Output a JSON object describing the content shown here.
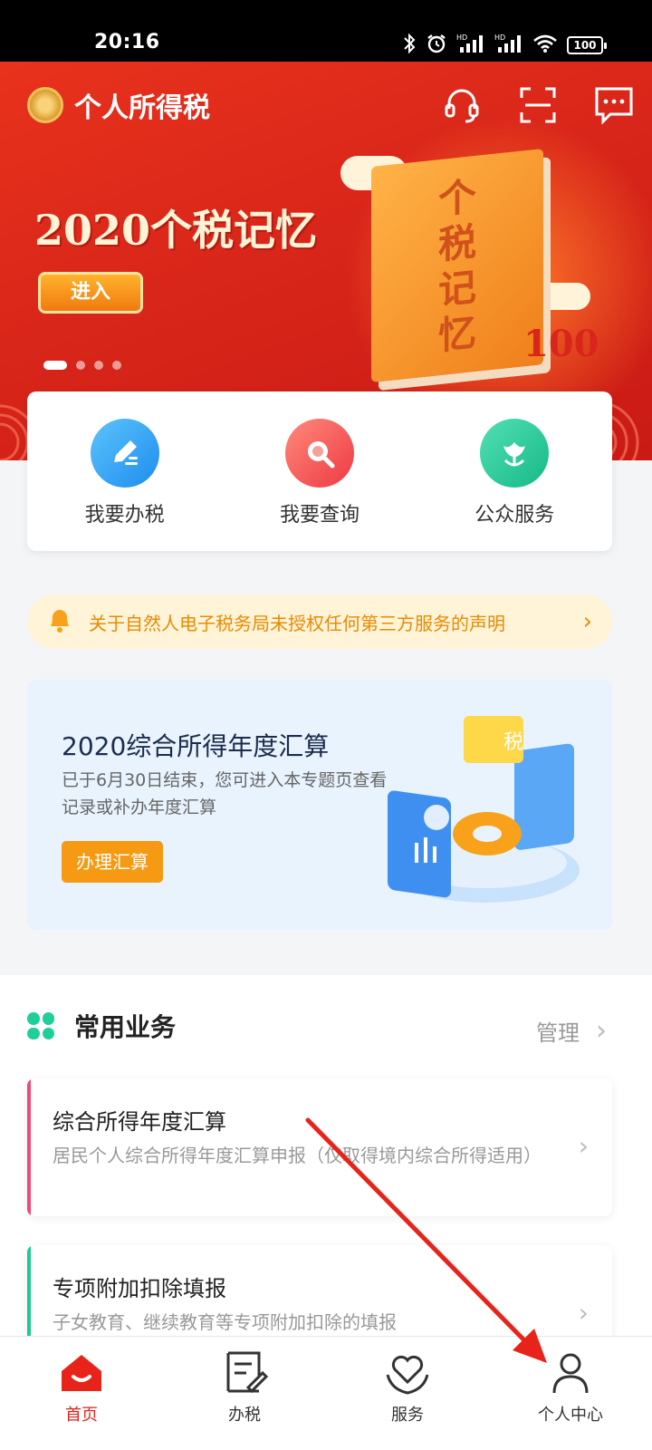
{
  "status_bar": {
    "time": "20:16",
    "battery": "100",
    "icons": [
      "bluetooth-icon",
      "alarm-icon",
      "signal-hd-icon",
      "signal-hd-icon",
      "wifi-icon",
      "battery-icon"
    ]
  },
  "header": {
    "app_title": "个人所得税",
    "icons": [
      "headset-icon",
      "scan-icon",
      "message-icon"
    ]
  },
  "banner": {
    "title": "2020个税记忆",
    "button": "进入",
    "book_text": "个税记忆",
    "badge": "100",
    "page_count": 4,
    "active_page": 1
  },
  "quick_actions": [
    {
      "label": "我要办税",
      "icon": "pen-icon",
      "color": "#2f9ff2"
    },
    {
      "label": "我要查询",
      "icon": "magnifier-icon",
      "color": "#f0484f"
    },
    {
      "label": "公众服务",
      "icon": "tulip-icon",
      "color": "#1fc994"
    }
  ],
  "notice": {
    "text": "关于自然人电子税务局未授权任何第三方服务的声明",
    "icon": "bell-icon"
  },
  "promo": {
    "title": "2020综合所得年度汇算",
    "desc": "已于6月30日结束，您可进入本专题页查看记录或补办年度汇算",
    "button": "办理汇算",
    "illus_label": "税"
  },
  "common_services": {
    "title": "常用业务",
    "manage": "管理",
    "items": [
      {
        "title": "综合所得年度汇算",
        "desc": "居民个人综合所得年度汇算申报（仅取得境内综合所得适用）",
        "accent": "#f0487a"
      },
      {
        "title": "专项附加扣除填报",
        "desc": "子女教育、继续教育等专项附加扣除的填报",
        "accent": "#1fc994"
      }
    ]
  },
  "tabbar": [
    {
      "label": "首页",
      "icon": "home-icon",
      "active": true
    },
    {
      "label": "办税",
      "icon": "form-icon",
      "active": false
    },
    {
      "label": "服务",
      "icon": "heart-hands-icon",
      "active": false
    },
    {
      "label": "个人中心",
      "icon": "person-icon",
      "active": false
    }
  ],
  "colors": {
    "brand_red": "#d9261a",
    "accent_orange": "#f59a12",
    "annotation_arrow": "#e8231a"
  }
}
